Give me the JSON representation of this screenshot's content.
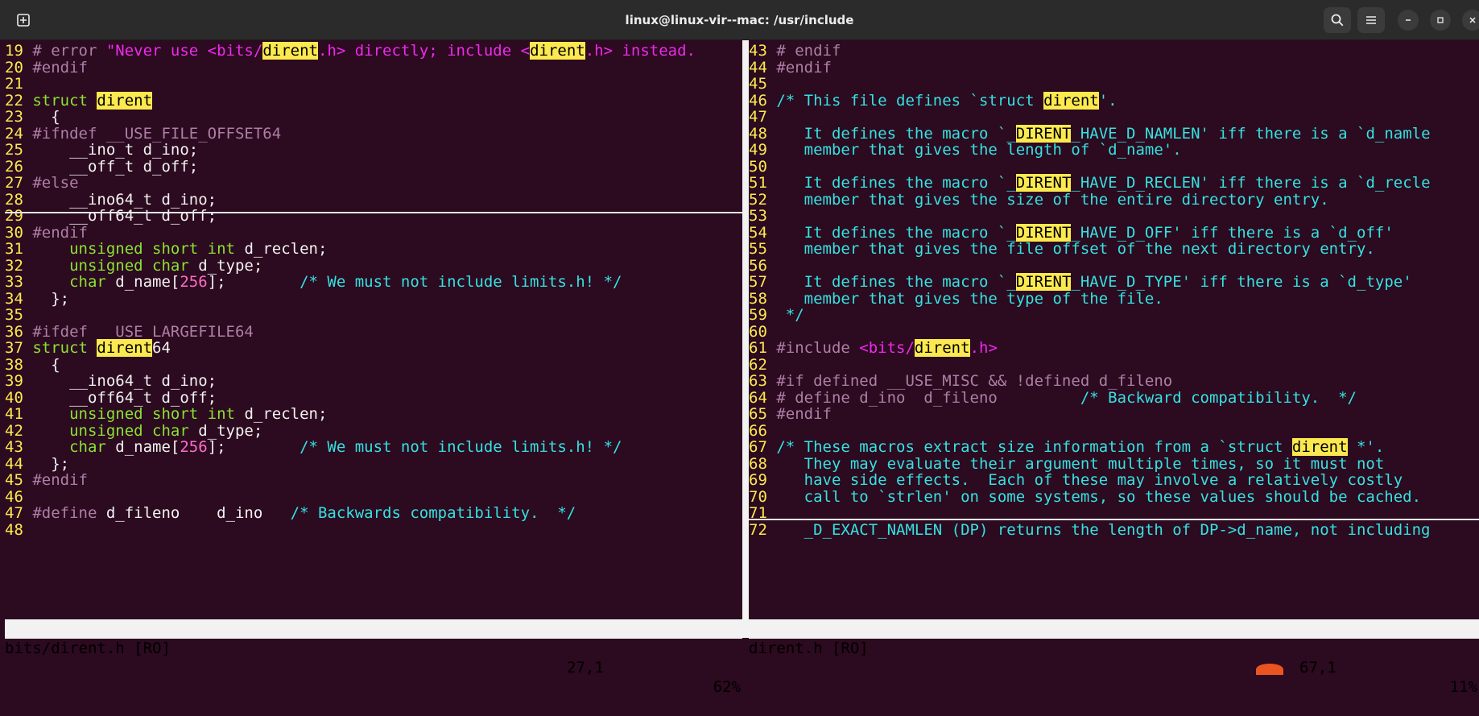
{
  "window": {
    "title": "linux@linux-vir--mac: /usr/include",
    "icons": [
      "new-tab-icon",
      "search-icon",
      "hamburger-menu-icon",
      "minimize-icon",
      "maximize-icon",
      "close-icon"
    ]
  },
  "colors": {
    "background": "#2c0a1f",
    "line_number": "#fce94f",
    "comment": "#34e2e2",
    "preprocessor": "#ad7fa8",
    "string": "#ef29ef",
    "type": "#8ae234",
    "search_highlight": "#fce94f"
  },
  "left_pane": {
    "file": "bits/dirent.h [RO]",
    "position": "27,1",
    "percent": "62%",
    "lines": [
      [
        [
          "ln",
          "19 "
        ],
        [
          "pre",
          "# error "
        ],
        [
          "str",
          "\"Never use <bits/"
        ],
        [
          "hl",
          "dirent"
        ],
        [
          "str",
          ".h> directly; include <"
        ],
        [
          "hl",
          "dirent"
        ],
        [
          "str",
          ".h> instead."
        ]
      ],
      [
        [
          "ln",
          "20 "
        ],
        [
          "pre",
          "#endif"
        ]
      ],
      [
        [
          "ln",
          "21 "
        ]
      ],
      [
        [
          "ln",
          "22 "
        ],
        [
          "kw",
          "struct "
        ],
        [
          "hl",
          "dirent"
        ]
      ],
      [
        [
          "ln",
          "23 "
        ],
        [
          "txt",
          "  {"
        ]
      ],
      [
        [
          "ln",
          "24 "
        ],
        [
          "pre",
          "#ifndef __USE_FILE_OFFSET64"
        ]
      ],
      [
        [
          "ln",
          "25 "
        ],
        [
          "txt",
          "    __ino_t d_ino;"
        ]
      ],
      [
        [
          "ln",
          "26 "
        ],
        [
          "txt",
          "    __off_t d_off;"
        ]
      ],
      [
        [
          "ln",
          "27 "
        ],
        [
          "pre",
          "#else"
        ]
      ],
      [
        [
          "ln",
          "28 "
        ],
        [
          "txt",
          "    __ino64_t d_ino;"
        ]
      ],
      [
        [
          "ln",
          "29 "
        ],
        [
          "txt",
          "    __off64_t d_off;"
        ]
      ],
      [
        [
          "ln",
          "30 "
        ],
        [
          "pre",
          "#endif"
        ]
      ],
      [
        [
          "ln",
          "31 "
        ],
        [
          "kw",
          "    unsigned short int "
        ],
        [
          "txt",
          "d_reclen;"
        ]
      ],
      [
        [
          "ln",
          "32 "
        ],
        [
          "kw",
          "    unsigned char "
        ],
        [
          "txt",
          "d_type;"
        ]
      ],
      [
        [
          "ln",
          "33 "
        ],
        [
          "kw",
          "    char "
        ],
        [
          "txt",
          "d_name["
        ],
        [
          "num",
          "256"
        ],
        [
          "txt",
          "];        "
        ],
        [
          "cmt",
          "/* We must not include limits.h! */"
        ]
      ],
      [
        [
          "ln",
          "34 "
        ],
        [
          "txt",
          "  };"
        ]
      ],
      [
        [
          "ln",
          "35 "
        ]
      ],
      [
        [
          "ln",
          "36 "
        ],
        [
          "pre",
          "#ifdef __USE_LARGEFILE64"
        ]
      ],
      [
        [
          "ln",
          "37 "
        ],
        [
          "kw",
          "struct "
        ],
        [
          "hl",
          "dirent"
        ],
        [
          "txt",
          "64"
        ]
      ],
      [
        [
          "ln",
          "38 "
        ],
        [
          "txt",
          "  {"
        ]
      ],
      [
        [
          "ln",
          "39 "
        ],
        [
          "txt",
          "    __ino64_t d_ino;"
        ]
      ],
      [
        [
          "ln",
          "40 "
        ],
        [
          "txt",
          "    __off64_t d_off;"
        ]
      ],
      [
        [
          "ln",
          "41 "
        ],
        [
          "kw",
          "    unsigned short int "
        ],
        [
          "txt",
          "d_reclen;"
        ]
      ],
      [
        [
          "ln",
          "42 "
        ],
        [
          "kw",
          "    unsigned char "
        ],
        [
          "txt",
          "d_type;"
        ]
      ],
      [
        [
          "ln",
          "43 "
        ],
        [
          "kw",
          "    char "
        ],
        [
          "txt",
          "d_name["
        ],
        [
          "num",
          "256"
        ],
        [
          "txt",
          "];        "
        ],
        [
          "cmt",
          "/* We must not include limits.h! */"
        ]
      ],
      [
        [
          "ln",
          "44 "
        ],
        [
          "txt",
          "  };"
        ]
      ],
      [
        [
          "ln",
          "45 "
        ],
        [
          "pre",
          "#endif"
        ]
      ],
      [
        [
          "ln",
          "46 "
        ]
      ],
      [
        [
          "ln",
          "47 "
        ],
        [
          "pre",
          "#define "
        ],
        [
          "txt",
          "d_fileno    d_ino   "
        ],
        [
          "cmt",
          "/* Backwards compatibility.  */"
        ]
      ],
      [
        [
          "ln",
          "48 "
        ]
      ]
    ]
  },
  "right_pane": {
    "file": "dirent.h [RO]",
    "position": "67,1",
    "percent": "11%",
    "lines": [
      [
        [
          "ln",
          "43 "
        ],
        [
          "pre",
          "# endif"
        ]
      ],
      [
        [
          "ln",
          "44 "
        ],
        [
          "pre",
          "#endif"
        ]
      ],
      [
        [
          "ln",
          "45 "
        ]
      ],
      [
        [
          "ln",
          "46 "
        ],
        [
          "cmt",
          "/* This file defines `struct "
        ],
        [
          "hl",
          "dirent"
        ],
        [
          "cmt",
          "'."
        ]
      ],
      [
        [
          "ln",
          "47 "
        ]
      ],
      [
        [
          "ln",
          "48 "
        ],
        [
          "cmt",
          "   It defines the macro `_"
        ],
        [
          "hl",
          "DIRENT"
        ],
        [
          "cmt",
          "_HAVE_D_NAMLEN' iff there is a `d_namle"
        ]
      ],
      [
        [
          "ln",
          "49 "
        ],
        [
          "cmt",
          "   member that gives the length of `d_name'."
        ]
      ],
      [
        [
          "ln",
          "50 "
        ]
      ],
      [
        [
          "ln",
          "51 "
        ],
        [
          "cmt",
          "   It defines the macro `_"
        ],
        [
          "hl",
          "DIRENT"
        ],
        [
          "cmt",
          "_HAVE_D_RECLEN' iff there is a `d_recle"
        ]
      ],
      [
        [
          "ln",
          "52 "
        ],
        [
          "cmt",
          "   member that gives the size of the entire directory entry."
        ]
      ],
      [
        [
          "ln",
          "53 "
        ]
      ],
      [
        [
          "ln",
          "54 "
        ],
        [
          "cmt",
          "   It defines the macro `_"
        ],
        [
          "hl",
          "DIRENT"
        ],
        [
          "cmt",
          "_HAVE_D_OFF' iff there is a `d_off'"
        ]
      ],
      [
        [
          "ln",
          "55 "
        ],
        [
          "cmt",
          "   member that gives the file offset of the next directory entry."
        ]
      ],
      [
        [
          "ln",
          "56 "
        ]
      ],
      [
        [
          "ln",
          "57 "
        ],
        [
          "cmt",
          "   It defines the macro `_"
        ],
        [
          "hl",
          "DIRENT"
        ],
        [
          "cmt",
          "_HAVE_D_TYPE' iff there is a `d_type'"
        ]
      ],
      [
        [
          "ln",
          "58 "
        ],
        [
          "cmt",
          "   member that gives the type of the file."
        ]
      ],
      [
        [
          "ln",
          "59 "
        ],
        [
          "cmt",
          " */"
        ]
      ],
      [
        [
          "ln",
          "60 "
        ]
      ],
      [
        [
          "ln",
          "61 "
        ],
        [
          "pre",
          "#include "
        ],
        [
          "str",
          "<bits/"
        ],
        [
          "hl",
          "dirent"
        ],
        [
          "str",
          ".h>"
        ]
      ],
      [
        [
          "ln",
          "62 "
        ]
      ],
      [
        [
          "ln",
          "63 "
        ],
        [
          "pre",
          "#if defined __USE_MISC && !defined d_fileno"
        ]
      ],
      [
        [
          "ln",
          "64 "
        ],
        [
          "pre",
          "# define d_ino  d_fileno         "
        ],
        [
          "cmt",
          "/* Backward compatibility.  */"
        ]
      ],
      [
        [
          "ln",
          "65 "
        ],
        [
          "pre",
          "#endif"
        ]
      ],
      [
        [
          "ln",
          "66 "
        ]
      ],
      [
        [
          "ln",
          "67 "
        ],
        [
          "cmt",
          "/* These macros extract size information from a `struct "
        ],
        [
          "hl",
          "dirent"
        ],
        [
          "cmt",
          " *'."
        ]
      ],
      [
        [
          "ln",
          "68 "
        ],
        [
          "cmt",
          "   They may evaluate their argument multiple times, so it must not"
        ]
      ],
      [
        [
          "ln",
          "69 "
        ],
        [
          "cmt",
          "   have side effects.  Each of these may involve a relatively costly"
        ]
      ],
      [
        [
          "ln",
          "70 "
        ],
        [
          "cmt",
          "   call to `strlen' on some systems, so these values should be cached."
        ]
      ],
      [
        [
          "ln",
          "71 "
        ]
      ],
      [
        [
          "ln",
          "72 "
        ],
        [
          "cmt",
          "   _D_EXACT_NAMLEN (DP) returns the length of DP->d_name, not including"
        ]
      ]
    ]
  }
}
